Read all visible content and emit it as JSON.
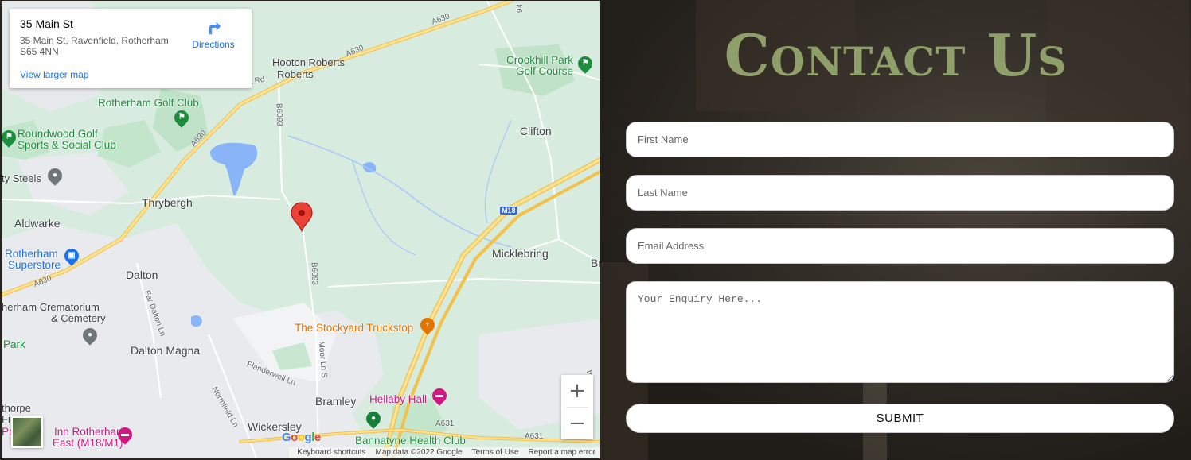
{
  "map": {
    "infocard": {
      "title": "35 Main St",
      "address": "35 Main St, Ravenfield, Rotherham S65 4NN",
      "directions_label": "Directions",
      "larger_map_link": "View larger map"
    },
    "places": {
      "hooton_roberts": "Hooton Roberts",
      "rotherham_golf_club": "Rotherham Golf Club",
      "roundwood_golf": "Roundwood Golf",
      "roundwood_golf_2": "Sports & Social Club",
      "city_steels": "ty Steels",
      "thrybergh": "Thrybergh",
      "aldwarke": "Aldwarke",
      "rotherham_superstore": "Rotherham",
      "rotherham_superstore_2": "Superstore",
      "dalton": "Dalton",
      "crematorium": "herham Crematorium",
      "crematorium_2": "& Cemetery",
      "park": "Park",
      "dalton_magna": "Dalton Magna",
      "crookhill_park": "Crookhill Park",
      "crookhill_park_2": "Golf Course",
      "clifton": "Clifton",
      "micklebring": "Micklebring",
      "br": "Br",
      "stockyard": "The Stockyard Truckstop",
      "hellaby_hall": "Hellaby Hall",
      "bramley": "Bramley",
      "wickersley": "Wickersley",
      "bannatyne": "Bannatyne Health Club",
      "premier_inn": "Inn Rotherham",
      "premier_inn_2": "East (M18/M1)",
      "thorpe": "thorpe",
      "pr": "Pr",
      "fi": "Fi"
    },
    "roads": {
      "a630_a": "A630",
      "a630_b": "A630",
      "a630_c": "A630",
      "a630_d": "A630",
      "b6093_a": "B6093",
      "b6093_b": "B6093",
      "m18": "M18",
      "a631_a": "A631",
      "a631_b": "A631",
      "moor_ln": "Moor Ln S",
      "flanderwell": "Flanderwell Ln",
      "far_dalton": "Far Dalton Ln",
      "normfield": "Normfield Ln",
      "first_rd": "rst Rd",
      "road_a": "A",
      "road_94": "94"
    },
    "zoom_in": "+",
    "zoom_out": "−",
    "google_logo": [
      "G",
      "o",
      "o",
      "g",
      "l",
      "e"
    ],
    "footer": [
      "Keyboard shortcuts",
      "Map data ©2022 Google",
      "Terms of Use",
      "Report a map error"
    ]
  },
  "contact": {
    "heading": "Contact Us",
    "first_name_placeholder": "First Name",
    "last_name_placeholder": "Last Name",
    "email_placeholder": "Email Address",
    "enquiry_placeholder": "Your Enquiry Here...",
    "submit_label": "SUBMIT"
  }
}
